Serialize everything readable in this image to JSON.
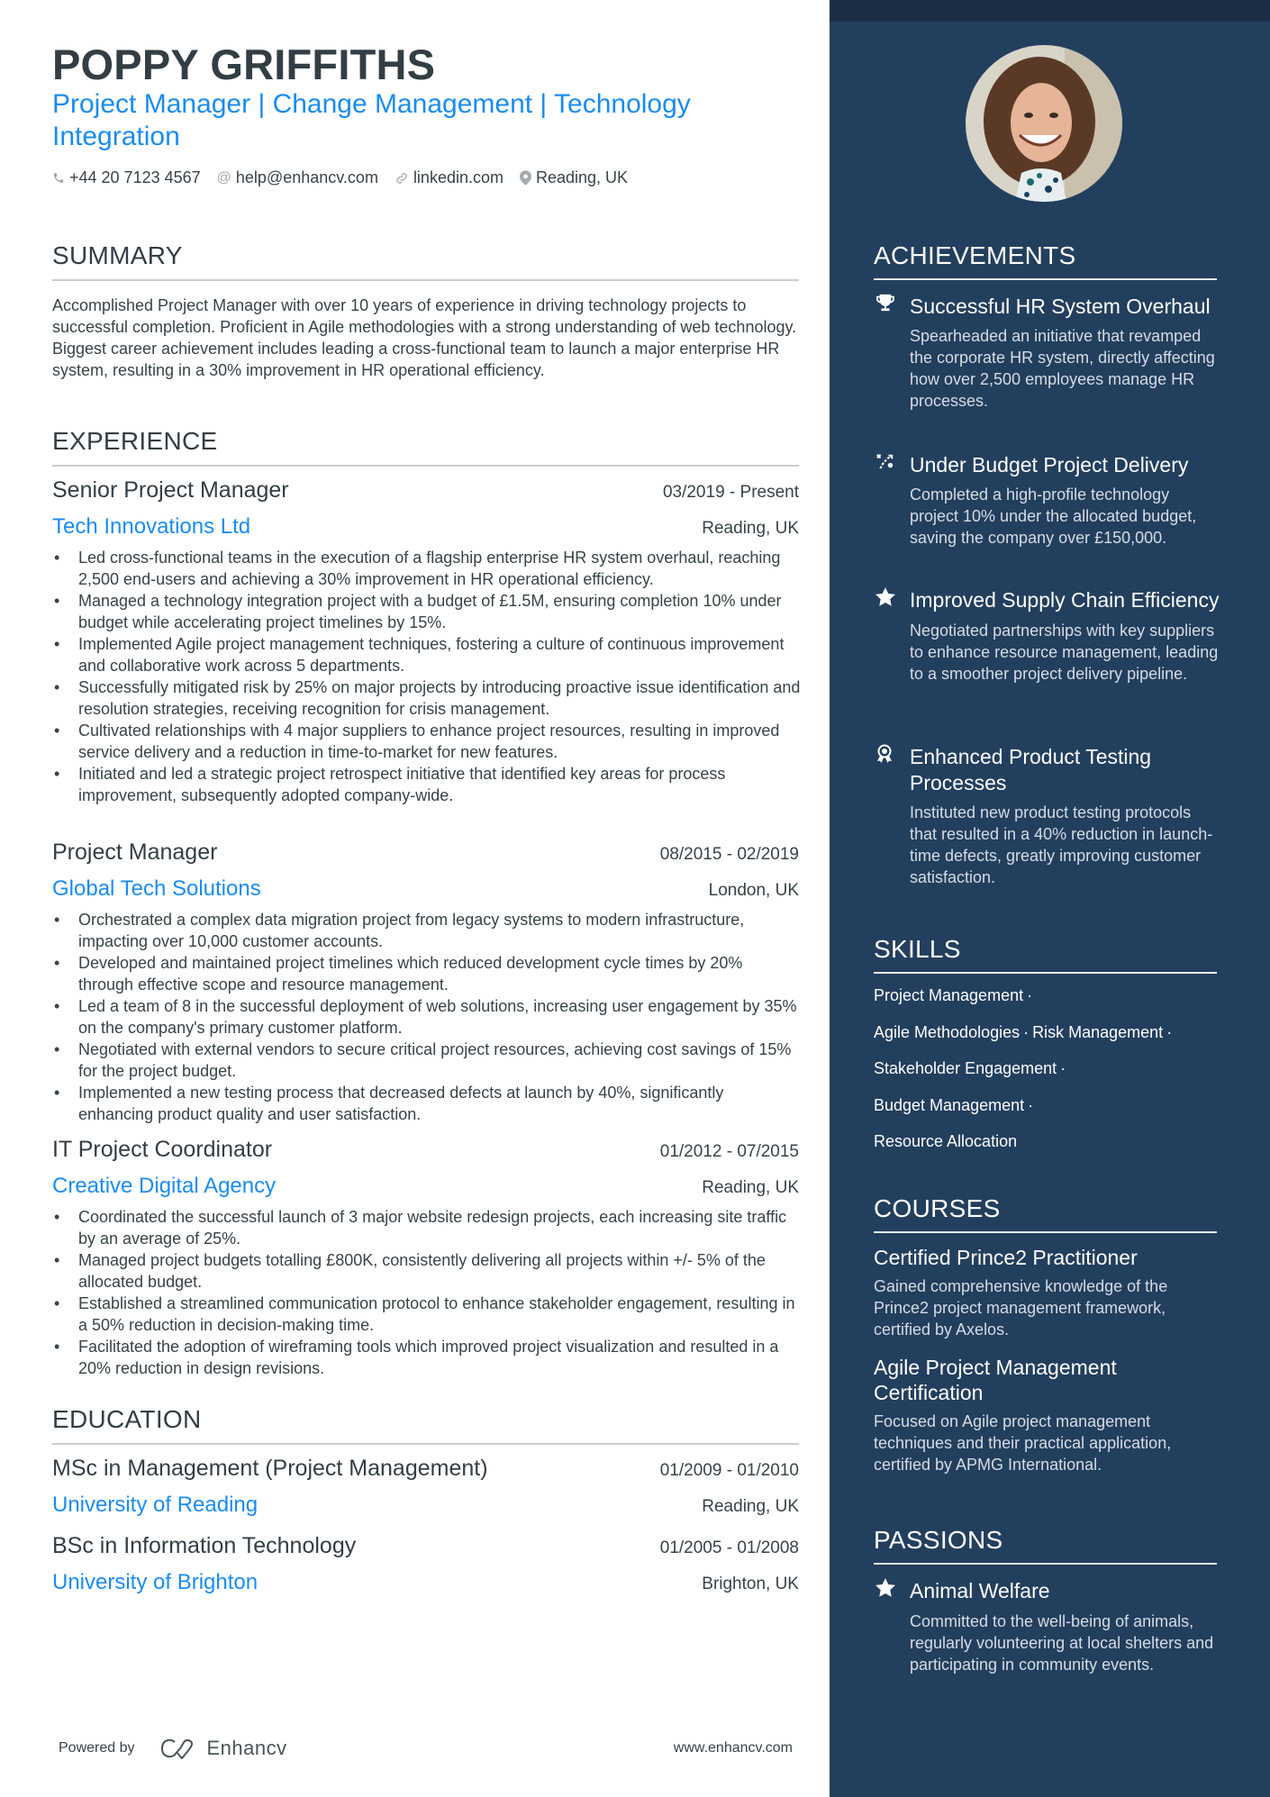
{
  "header": {
    "name": "POPPY GRIFFITHS",
    "title": "Project Manager | Change Management | Technology Integration",
    "contacts": [
      {
        "icon": "phone-icon",
        "text": "+44 20 7123 4567"
      },
      {
        "icon": "at-icon",
        "text": "help@enhancv.com"
      },
      {
        "icon": "link-icon",
        "text": "linkedin.com"
      },
      {
        "icon": "location-icon",
        "text": "Reading, UK"
      }
    ]
  },
  "summary": {
    "heading": "SUMMARY",
    "text": "Accomplished Project Manager with over 10 years of experience in driving technology projects to successful completion. Proficient in Agile methodologies with a strong understanding of web technology. Biggest career achievement includes leading a cross-functional team to launch a major enterprise HR system, resulting in a 30% improvement in HR operational efficiency."
  },
  "experience": {
    "heading": "EXPERIENCE",
    "jobs": [
      {
        "role": "Senior Project Manager",
        "dates": "03/2019 - Present",
        "company": "Tech Innovations Ltd",
        "location": "Reading, UK",
        "bullets": [
          "Led cross-functional teams in the execution of a flagship enterprise HR system overhaul, reaching 2,500 end-users and achieving a 30% improvement in HR operational efficiency.",
          "Managed a technology integration project with a budget of £1.5M, ensuring completion 10% under budget while accelerating project timelines by 15%.",
          "Implemented Agile project management techniques, fostering a culture of continuous improvement and collaborative work across 5 departments.",
          "Successfully mitigated risk by 25% on major projects by introducing proactive issue identification and resolution strategies, receiving recognition for crisis management.",
          "Cultivated relationships with 4 major suppliers to enhance project resources, resulting in improved service delivery and a reduction in time-to-market for new features.",
          "Initiated and led a strategic project retrospect initiative that identified key areas for process improvement, subsequently adopted company-wide."
        ]
      },
      {
        "role": "Project Manager",
        "dates": "08/2015 - 02/2019",
        "company": "Global Tech Solutions",
        "location": "London, UK",
        "bullets": [
          "Orchestrated a complex data migration project from legacy systems to modern infrastructure, impacting over 10,000 customer accounts.",
          "Developed and maintained project timelines which reduced development cycle times by 20% through effective scope and resource management.",
          "Led a team of 8 in the successful deployment of web solutions, increasing user engagement by 35% on the company's primary customer platform.",
          "Negotiated with external vendors to secure critical project resources, achieving cost savings of 15% for the project budget.",
          "Implemented a new testing process that decreased defects at launch by 40%, significantly enhancing product quality and user satisfaction."
        ]
      },
      {
        "role": "IT Project Coordinator",
        "dates": "01/2012 - 07/2015",
        "company": "Creative Digital Agency",
        "location": "Reading, UK",
        "bullets": [
          "Coordinated the successful launch of 3 major website redesign projects, each increasing site traffic by an average of 25%.",
          "Managed project budgets totalling £800K, consistently delivering all projects within +/- 5% of the allocated budget.",
          "Established a streamlined communication protocol to enhance stakeholder engagement, resulting in a 50% reduction in decision-making time.",
          "Facilitated the adoption of wireframing tools which improved project visualization and resulted in a 20% reduction in design revisions."
        ]
      }
    ]
  },
  "education": {
    "heading": "EDUCATION",
    "items": [
      {
        "degree": "MSc in Management (Project Management)",
        "dates": "01/2009 - 01/2010",
        "school": "University of Reading",
        "location": "Reading, UK"
      },
      {
        "degree": "BSc in Information Technology",
        "dates": "01/2005 - 01/2008",
        "school": "University of Brighton",
        "location": "Brighton, UK"
      }
    ]
  },
  "footer": {
    "powered_by": "Powered by",
    "brand": "Enhancv",
    "website": "www.enhancv.com"
  },
  "achievements": {
    "heading": "ACHIEVEMENTS",
    "items": [
      {
        "icon": "trophy-icon",
        "title": "Successful HR System Overhaul",
        "description": "Spearheaded an initiative that revamped the corporate HR system, directly affecting how over 2,500 employees manage HR processes."
      },
      {
        "icon": "strategy-icon",
        "title": "Under Budget Project Delivery",
        "description": "Completed a high-profile technology project 10% under the allocated budget, saving the company over £150,000."
      },
      {
        "icon": "star-icon",
        "title": "Improved Supply Chain Efficiency",
        "description": "Negotiated partnerships with key suppliers to enhance resource management, leading to a smoother project delivery pipeline."
      },
      {
        "icon": "award-ribbon-icon",
        "title": "Enhanced Product Testing Processes",
        "description": "Instituted new product testing protocols that resulted in a 40% reduction in launch-time defects, greatly improving customer satisfaction."
      }
    ]
  },
  "skills": {
    "heading": "SKILLS",
    "items": [
      "Project Management",
      "Agile Methodologies",
      "Risk Management",
      "Stakeholder Engagement",
      "Budget Management",
      "Resource Allocation"
    ],
    "separator": "·"
  },
  "courses": {
    "heading": "COURSES",
    "items": [
      {
        "title": "Certified Prince2 Practitioner",
        "description": "Gained comprehensive knowledge of the Prince2 project management framework, certified by Axelos."
      },
      {
        "title": "Agile Project Management Certification",
        "description": "Focused on Agile project management techniques and their practical application, certified by APMG International."
      }
    ]
  },
  "passions": {
    "heading": "PASSIONS",
    "items": [
      {
        "icon": "star-icon",
        "title": "Animal Welfare",
        "description": "Committed to the well-being of animals, regularly volunteering at local shelters and participating in community events."
      }
    ]
  },
  "colors": {
    "accent": "#1a8cf0",
    "sidebar": "#233f5e",
    "sidebar_top": "#1b2e45",
    "text": "#384347"
  }
}
